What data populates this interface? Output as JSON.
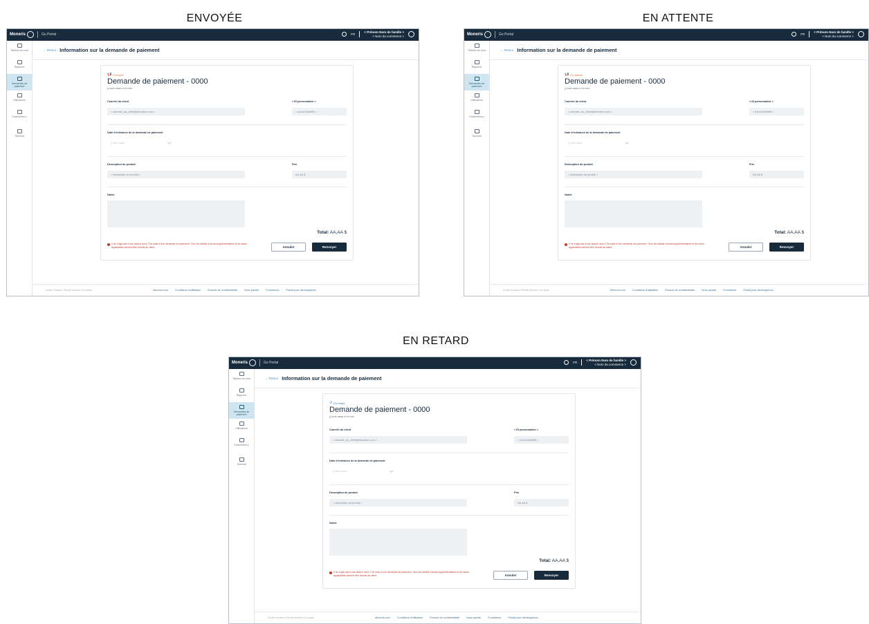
{
  "panels": [
    {
      "caption": "ENVOYÉE",
      "status_label": "Envoyée",
      "status_icon": "megaphone-icon",
      "status_color": "#e8703a"
    },
    {
      "caption": "EN ATTENTE",
      "status_label": "En attente",
      "status_icon": "megaphone-icon",
      "status_color": "#e8703a"
    },
    {
      "caption": "EN RETARD",
      "status_label": "En retard",
      "status_icon": "clock-back-icon",
      "status_color": "#3a7bb8"
    }
  ],
  "app": {
    "logo": "Moneris",
    "portal": "Go Portal",
    "lang": "FR",
    "user_name": "< Prénom Nom de famille >",
    "merchant": "< Nom du commerce >",
    "brand_color": "#172b3d"
  },
  "sidebar": {
    "items": [
      {
        "label": "Tableau de bord",
        "icon": "dashboard-icon"
      },
      {
        "label": "Rapports",
        "icon": "report-icon"
      },
      {
        "label": "Demandes de paiement",
        "icon": "payment-request-icon"
      },
      {
        "label": "Utilisateurs",
        "icon": "users-icon"
      },
      {
        "label": "Paramètres ▸",
        "icon": "gear-icon"
      },
      {
        "label": "Terminal",
        "icon": "terminal-icon"
      }
    ]
  },
  "page": {
    "back": "← Retour",
    "title": "Information sur la demande de paiement"
  },
  "form": {
    "request_title": "Demande de paiement - 0000",
    "request_date": "jj mois aaaa à hh:mm",
    "email_label": "Courriel du client",
    "email_value": "< adresse_du_client@domaine.com >",
    "custom_id_label": "< ID personnalisé >",
    "custom_id_value": "< a1b2c3d4e5f6 >",
    "due_label": "Date d'échéance de la demande de paiement",
    "due_value": "jj mois aaaa",
    "desc_label": "Description du produit",
    "desc_value": "< description du produit >",
    "price_label": "Prix",
    "price_value": "AA,AA $",
    "notes_label": "Notes",
    "total_label": "Total:",
    "total_value": "AA,AA  $",
    "warning": "Il ne s'agit pas d'une facture avec TVA mais d'une demande de paiement. Tous les détails d'achat supplémentaires et les taxes applicables doivent être fournis au client.",
    "cancel": "Annuler",
    "resend": "Renvoyer"
  },
  "footer": {
    "copyright": "Droits d'auteur Portail Moneris Go aaaa",
    "links": [
      "Moneris.com",
      "Conditions d'utilisation",
      "Énoncé de confidentialité",
      "Nous joindre",
      "Fournitures",
      "Portail pour développeurs"
    ]
  }
}
